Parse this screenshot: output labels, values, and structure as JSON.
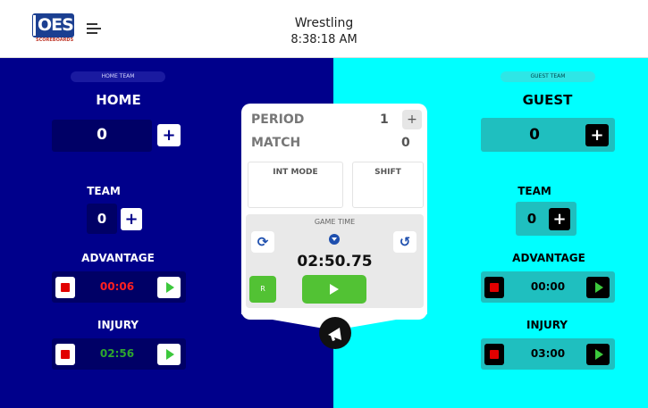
{
  "header": {
    "logo_text": "OES",
    "logo_subtext": "SCOREBOARDS",
    "title": "Wrestling",
    "time": "8:38:18 AM"
  },
  "home": {
    "chip": "HOME TEAM",
    "name": "HOME",
    "score": "0",
    "plus": "+",
    "team_label": "TEAM",
    "team_score": "0",
    "advantage_label": "ADVANTAGE",
    "advantage_time": "00:06",
    "injury_label": "INJURY",
    "injury_time": "02:56"
  },
  "guest": {
    "chip": "GUEST TEAM",
    "name": "GUEST",
    "score": "0",
    "plus": "+",
    "team_label": "TEAM",
    "team_score": "0",
    "advantage_label": "ADVANTAGE",
    "advantage_time": "00:00",
    "injury_label": "INJURY",
    "injury_time": "03:00"
  },
  "center": {
    "period_label": "PERIOD",
    "period_value": "1",
    "period_plus": "+",
    "match_label": "MATCH",
    "match_value": "0",
    "int_mode_label": "INT MODE",
    "shift_label": "SHIFT",
    "game_time_label": "GAME TIME",
    "game_time": "02:50.75",
    "refresh_glyph": "⟳",
    "undo_glyph": "↺",
    "r_label": "R"
  },
  "colors": {
    "home_bg": "#00008b",
    "guest_bg": "#00ffff",
    "start_green": "#52c234",
    "stop_red": "#e10000",
    "advantage_home_red": "#ff2020",
    "injury_home_green": "#2ea62e"
  },
  "icons": {
    "menu": "hamburger-icon",
    "refresh": "refresh-icon",
    "undo": "undo-icon",
    "down": "arrow-down-circle-icon",
    "horn": "megaphone-icon"
  }
}
